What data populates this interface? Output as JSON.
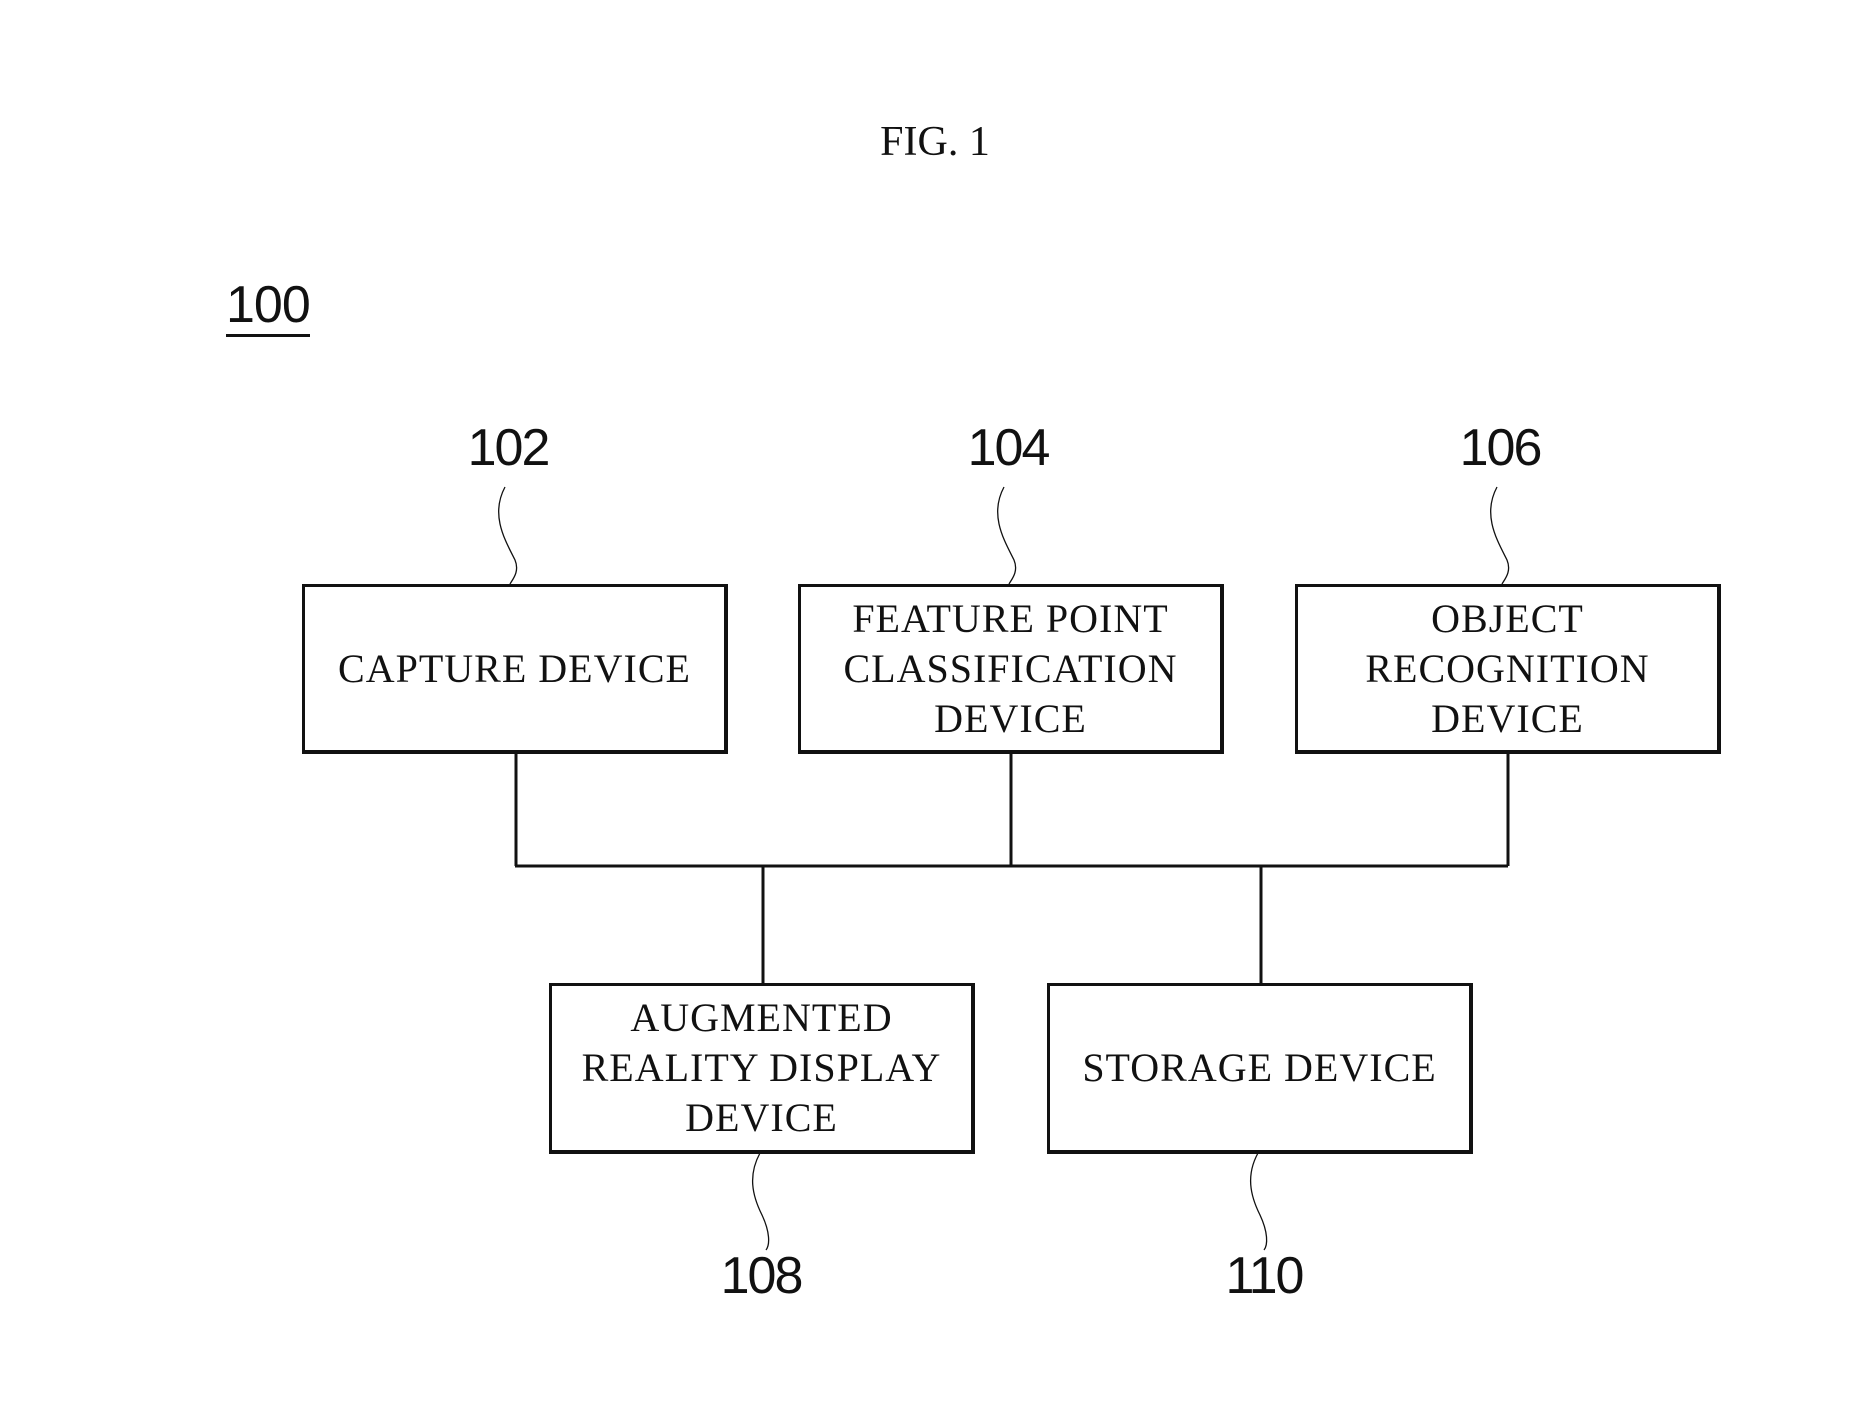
{
  "figure": {
    "title": "FIG. 1",
    "system_reference": "100"
  },
  "blocks": [
    {
      "id": "capture",
      "label": "CAPTURE DEVICE",
      "reference": "102"
    },
    {
      "id": "feature",
      "label": "FEATURE POINT\nCLASSIFICATION\nDEVICE",
      "reference": "104"
    },
    {
      "id": "object",
      "label": "OBJECT\nRECOGNITION\nDEVICE",
      "reference": "106"
    },
    {
      "id": "ar-display",
      "label": "AUGMENTED\nREALITY DISPLAY\nDEVICE",
      "reference": "108"
    },
    {
      "id": "storage",
      "label": "STORAGE DEVICE",
      "reference": "110"
    }
  ],
  "connections": [
    {
      "from": "capture",
      "to": "bus"
    },
    {
      "from": "feature",
      "to": "bus"
    },
    {
      "from": "object",
      "to": "bus"
    },
    {
      "from": "bus",
      "to": "ar-display"
    },
    {
      "from": "bus",
      "to": "storage"
    }
  ]
}
